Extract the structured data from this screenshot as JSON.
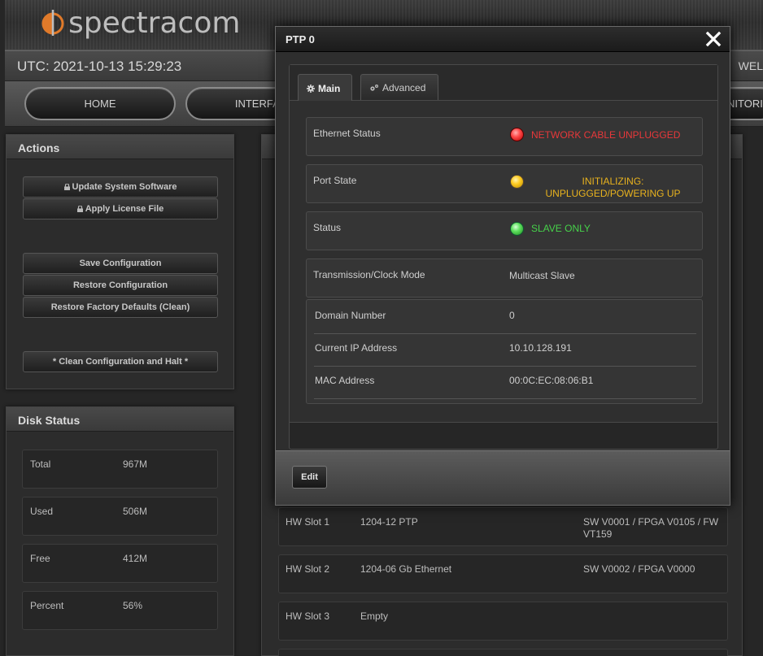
{
  "header": {
    "brand": "spectracom",
    "utc": "UTC: 2021-10-13 15:29:23",
    "welcome": "WEL"
  },
  "nav": {
    "items": [
      "HOME",
      "INTERFAC",
      "NITORI"
    ]
  },
  "actions": {
    "title": "Actions",
    "buttons": [
      "Update System Software",
      "Apply License File",
      "Save Configuration",
      "Restore Configuration",
      "Restore Factory Defaults (Clean)",
      "* Clean Configuration and Halt *"
    ]
  },
  "disk": {
    "title": "Disk Status",
    "rows": [
      {
        "label": "Total",
        "value": "967M"
      },
      {
        "label": "Used",
        "value": "506M"
      },
      {
        "label": "Free",
        "value": "412M"
      },
      {
        "label": "Percent",
        "value": "56%"
      }
    ]
  },
  "hw": {
    "rows": [
      {
        "slot": "HW Slot 1",
        "module": "1204-12 PTP",
        "version": "SW V0001 / FPGA V0105 / FW VT159"
      },
      {
        "slot": "HW Slot 2",
        "module": "1204-06 Gb Ethernet",
        "version": "SW V0002 / FPGA V0000"
      },
      {
        "slot": "HW Slot 3",
        "module": "Empty",
        "version": ""
      }
    ]
  },
  "modal": {
    "title": "PTP 0",
    "tabs": {
      "main": "Main",
      "advanced": "Advanced"
    },
    "fields": {
      "ethernet_label": "Ethernet Status",
      "ethernet_value": "NETWORK CABLE UNPLUGGED",
      "port_label": "Port State",
      "port_value_1": "INITIALIZING:",
      "port_value_2": "UNPLUGGED/POWERING UP",
      "status_label": "Status",
      "status_value": "SLAVE ONLY",
      "mode_label": "Transmission/Clock Mode",
      "mode_value": "Multicast Slave",
      "domain_label": "Domain Number",
      "domain_value": "0",
      "ip_label": "Current IP Address",
      "ip_value": "10.10.128.191",
      "mac_label": "MAC Address",
      "mac_value": "00:0C:EC:08:06:B1"
    },
    "edit_label": "Edit"
  },
  "colors": {
    "error": "#e8383a",
    "warning": "#e8b21e",
    "ok": "#46d24a"
  }
}
